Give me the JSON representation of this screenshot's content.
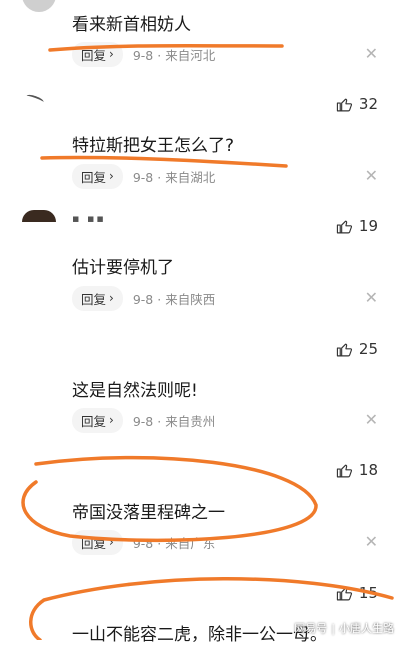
{
  "comments": [
    {
      "text": "看来新首相妨人",
      "reply_label": "回复",
      "date": "9-8",
      "location": "来自河北",
      "likes": ""
    },
    {
      "text": "特拉斯把女王怎么了?",
      "reply_label": "回复",
      "date": "9-8",
      "location": "来自湖北",
      "likes": "32"
    },
    {
      "text": "估计要停机了",
      "reply_label": "回复",
      "date": "9-8",
      "location": "来自陕西",
      "likes": "19"
    },
    {
      "text": "这是自然法则呢!",
      "reply_label": "回复",
      "date": "9-8",
      "location": "来自贵州",
      "likes": "25"
    },
    {
      "text": "帝国没落里程碑之一",
      "reply_label": "回复",
      "date": "9-8",
      "location": "来自广东",
      "likes": "18"
    },
    {
      "text": "一山不能容二虎，除非一公一母。",
      "likes": "15"
    }
  ],
  "meta_separator": "·",
  "watermark": {
    "source": "网易号",
    "account": "小唐人生路"
  },
  "colors": {
    "annotation": "#f07a2a",
    "muted": "#8a8a8a",
    "text": "#1a1a1a"
  },
  "icons": {
    "reply_chevron": "chevron-right-icon",
    "like": "thumbs-up-icon",
    "close": "close-icon"
  }
}
